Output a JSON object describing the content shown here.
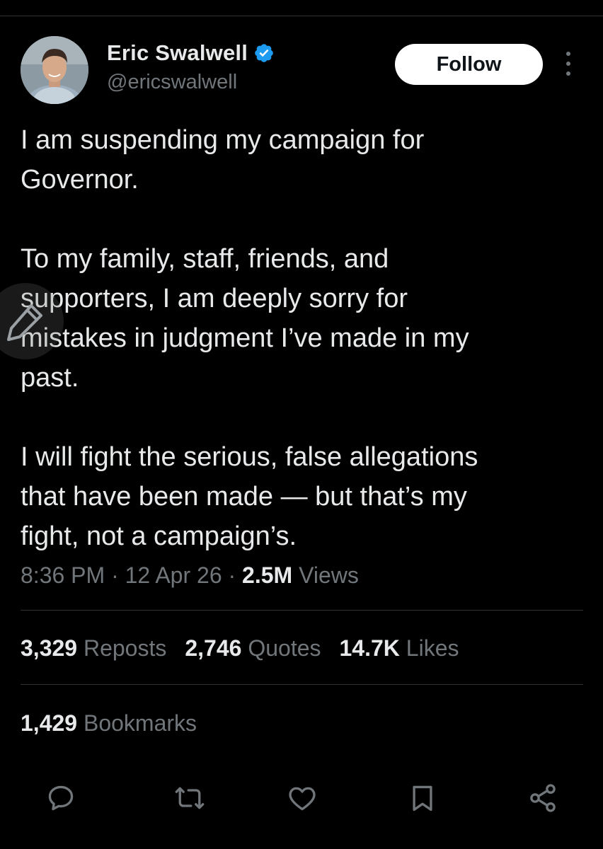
{
  "author": {
    "display_name": "Eric Swalwell",
    "handle": "@ericswalwell",
    "verified": true
  },
  "follow_button": {
    "label": "Follow"
  },
  "tweet": {
    "paragraphs": [
      "I am suspending my campaign for\nGovernor.",
      "To my family, staff, friends, and\nsupporters, I am deeply sorry for\nmistakes in judgment I’ve made in my\npast.",
      "I will fight the serious, false allegations\nthat have been made — but that’s my\nfight, not a campaign’s."
    ]
  },
  "meta": {
    "time": "8:36 PM",
    "separator": " · ",
    "date": "12 Apr 26",
    "views_count": "2.5M",
    "views_label": " Views"
  },
  "stats": {
    "reposts_count": "3,329",
    "reposts_label": " Reposts",
    "quotes_count": "2,746",
    "quotes_label": " Quotes",
    "likes_count": "14.7K",
    "likes_label": " Likes",
    "bookmarks_count": "1,429",
    "bookmarks_label": " Bookmarks"
  },
  "icons": {
    "verified": "verified-badge-icon",
    "more": "more-vertical-icon",
    "reply": "reply-icon",
    "repost": "repost-icon",
    "like": "heart-icon",
    "bookmark": "bookmark-icon",
    "share": "share-icon",
    "edit": "compose-pencil-icon"
  },
  "colors": {
    "background": "#000000",
    "text_primary": "#e7e9ea",
    "text_secondary": "#71767b",
    "divider": "#2f3336",
    "verified_blue": "#1d9bf0",
    "follow_bg": "#ffffff"
  }
}
